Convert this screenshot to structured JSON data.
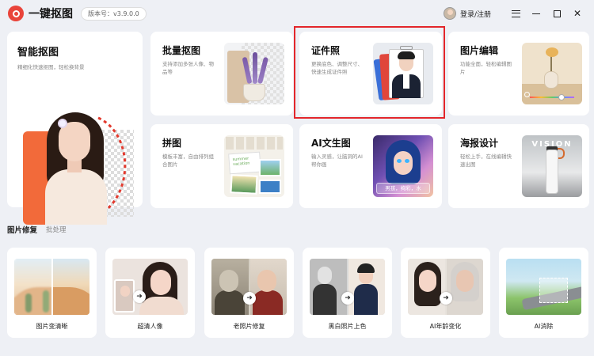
{
  "app": {
    "name": "一键抠图",
    "version": "版本号：v3.9.0.0",
    "login": "登录/注册"
  },
  "feature_cards": {
    "smart_cutout": {
      "title": "智能抠图",
      "desc": "精细化快速抠图，轻松换背景"
    },
    "batch_cutout": {
      "title": "批量抠图",
      "desc": "支持添加多张人像、物品等"
    },
    "id_photo": {
      "title": "证件照",
      "desc": "更换底色、调整尺寸、快速生成证件照"
    },
    "photo_edit": {
      "title": "图片编辑",
      "desc": "功能全面，轻松编辑图片"
    },
    "collage": {
      "title": "拼图",
      "desc": "模板丰富，自由排列组合图片",
      "thumb_text": "summer vacation"
    },
    "ai_text_image": {
      "title": "AI文生图",
      "desc": "输入灵感，让脑洞的AI帮你画",
      "tag": "男孩，绚彩，水"
    },
    "poster": {
      "title": "海报设计",
      "desc": "轻松上手，在线编辑快速出图",
      "thumb_text": "VISION"
    }
  },
  "section": {
    "title": "图片修复",
    "tab": "批处理"
  },
  "tools": [
    {
      "label": "图片变清晰"
    },
    {
      "label": "超清人像"
    },
    {
      "label": "老照片修复"
    },
    {
      "label": "黑白照片上色"
    },
    {
      "label": "AI年龄变化"
    },
    {
      "label": "AI消除"
    }
  ],
  "colors": {
    "background": "#eef0f5",
    "brand_red": "#e9443a",
    "highlight_border": "#e3262b"
  }
}
